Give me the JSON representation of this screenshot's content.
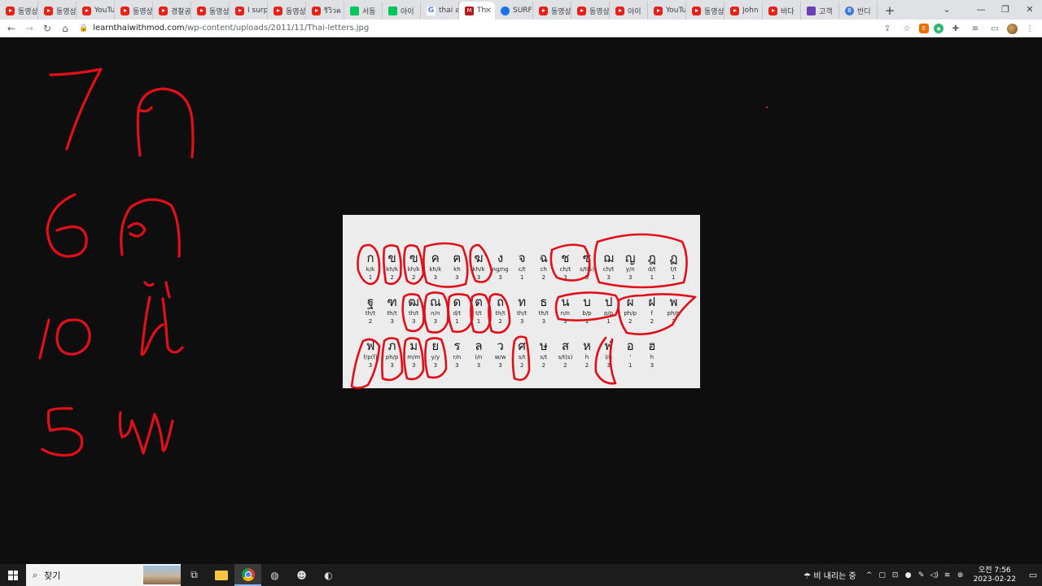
{
  "tabs": [
    {
      "favicon": "youtube-icon",
      "label": "동영상"
    },
    {
      "favicon": "youtube-icon",
      "label": "동영상"
    },
    {
      "favicon": "youtube-icon",
      "label": "YouTube"
    },
    {
      "favicon": "youtube-icon",
      "label": "동영상"
    },
    {
      "favicon": "youtube-icon",
      "label": "경찰공"
    },
    {
      "favicon": "youtube-icon",
      "label": "동영상"
    },
    {
      "favicon": "youtube-icon",
      "label": "I surp"
    },
    {
      "favicon": "youtube-icon",
      "label": "동영상"
    },
    {
      "favicon": "youtube-icon",
      "label": "รีวิวค"
    },
    {
      "favicon": "naver-icon",
      "label": "서동"
    },
    {
      "favicon": "naver-icon",
      "label": "아이"
    },
    {
      "favicon": "google-icon",
      "label": "thai a"
    },
    {
      "favicon": "m-icon",
      "label": "Th",
      "active": true
    },
    {
      "favicon": "surf-icon",
      "label": "SURF"
    },
    {
      "favicon": "youtube-icon",
      "label": "동영상"
    },
    {
      "favicon": "youtube-icon",
      "label": "동영상"
    },
    {
      "favicon": "youtube-icon",
      "label": "아이"
    },
    {
      "favicon": "youtube-icon",
      "label": "YouTu"
    },
    {
      "favicon": "youtube-icon",
      "label": "동영상"
    },
    {
      "favicon": "youtube-icon",
      "label": "John"
    },
    {
      "favicon": "youtube-icon",
      "label": "바다"
    },
    {
      "favicon": "purple-icon",
      "label": "고객"
    },
    {
      "favicon": "b-icon",
      "label": "반디"
    }
  ],
  "address": {
    "domain": "learnthaiwithmod.com",
    "path": "/wp-content/uploads/2011/11/Thai-letters.jpg"
  },
  "thai_chart": {
    "rows": [
      [
        {
          "letter": "ก",
          "sound": "k/k",
          "cls": "1"
        },
        {
          "letter": "ข",
          "sound": "kh/k",
          "cls": "2"
        },
        {
          "letter": "ฃ",
          "sound": "kh/k",
          "cls": "2"
        },
        {
          "letter": "ค",
          "sound": "kh/k",
          "cls": "3"
        },
        {
          "letter": "ฅ",
          "sound": "kh",
          "cls": "3"
        },
        {
          "letter": "ฆ",
          "sound": "kh/k",
          "cls": "3"
        },
        {
          "letter": "ง",
          "sound": "ng/ng",
          "cls": "3"
        },
        {
          "letter": "จ",
          "sound": "c/t",
          "cls": "1"
        },
        {
          "letter": "ฉ",
          "sound": "ch",
          "cls": "2"
        },
        {
          "letter": "ช",
          "sound": "ch/t",
          "cls": "3"
        },
        {
          "letter": "ซ",
          "sound": "s/t(s)",
          "cls": "3"
        },
        {
          "letter": "ฌ",
          "sound": "ch/t",
          "cls": "3"
        },
        {
          "letter": "ญ",
          "sound": "y/n",
          "cls": "3"
        },
        {
          "letter": "ฎ",
          "sound": "d/t",
          "cls": "1"
        },
        {
          "letter": "ฏ",
          "sound": "t/t",
          "cls": "1"
        }
      ],
      [
        {
          "letter": "ฐ",
          "sound": "th/t",
          "cls": "2"
        },
        {
          "letter": "ฑ",
          "sound": "th/t",
          "cls": "3"
        },
        {
          "letter": "ฒ",
          "sound": "th/t",
          "cls": "3"
        },
        {
          "letter": "ณ",
          "sound": "n/n",
          "cls": "3"
        },
        {
          "letter": "ด",
          "sound": "d/t",
          "cls": "1"
        },
        {
          "letter": "ต",
          "sound": "t/t",
          "cls": "1"
        },
        {
          "letter": "ถ",
          "sound": "th/t",
          "cls": "2"
        },
        {
          "letter": "ท",
          "sound": "th/t",
          "cls": "3"
        },
        {
          "letter": "ธ",
          "sound": "th/t",
          "cls": "3"
        },
        {
          "letter": "น",
          "sound": "n/n",
          "cls": "3"
        },
        {
          "letter": "บ",
          "sound": "b/p",
          "cls": "1"
        },
        {
          "letter": "ป",
          "sound": "p/p",
          "cls": "1"
        },
        {
          "letter": "ผ",
          "sound": "ph/p",
          "cls": "2"
        },
        {
          "letter": "ฝ",
          "sound": "f",
          "cls": "2"
        },
        {
          "letter": "พ",
          "sound": "ph/p",
          "cls": "3"
        }
      ],
      [
        {
          "letter": "ฟ",
          "sound": "f/p(f)",
          "cls": "3"
        },
        {
          "letter": "ภ",
          "sound": "ph/p",
          "cls": "3"
        },
        {
          "letter": "ม",
          "sound": "m/m",
          "cls": "3"
        },
        {
          "letter": "ย",
          "sound": "y/y",
          "cls": "3"
        },
        {
          "letter": "ร",
          "sound": "r/n",
          "cls": "3"
        },
        {
          "letter": "ล",
          "sound": "l/n",
          "cls": "3"
        },
        {
          "letter": "ว",
          "sound": "w/w",
          "cls": "3"
        },
        {
          "letter": "ศ",
          "sound": "s/t",
          "cls": "2"
        },
        {
          "letter": "ษ",
          "sound": "s/t",
          "cls": "2"
        },
        {
          "letter": "ส",
          "sound": "s/t(s)",
          "cls": "2"
        },
        {
          "letter": "ห",
          "sound": "h",
          "cls": "2"
        },
        {
          "letter": "ฬ",
          "sound": "l/n",
          "cls": "3"
        },
        {
          "letter": "อ",
          "sound": "'",
          "cls": "1"
        },
        {
          "letter": "ฮ",
          "sound": "h",
          "cls": "3"
        }
      ]
    ]
  },
  "handwriting": [
    {
      "number": "7",
      "letter": "ก"
    },
    {
      "number": "6",
      "letter": "ค"
    },
    {
      "number": "10",
      "letter": "น"
    },
    {
      "number": "5",
      "letter": "พ"
    }
  ],
  "taskbar": {
    "search_label": "찾기",
    "weather": "비 내리는 중",
    "time": "오전 7:56",
    "date": "2023-02-22"
  },
  "colors": {
    "annotation": "#e0101a",
    "background": "#0e0e0e",
    "image_bg": "#ececec"
  }
}
